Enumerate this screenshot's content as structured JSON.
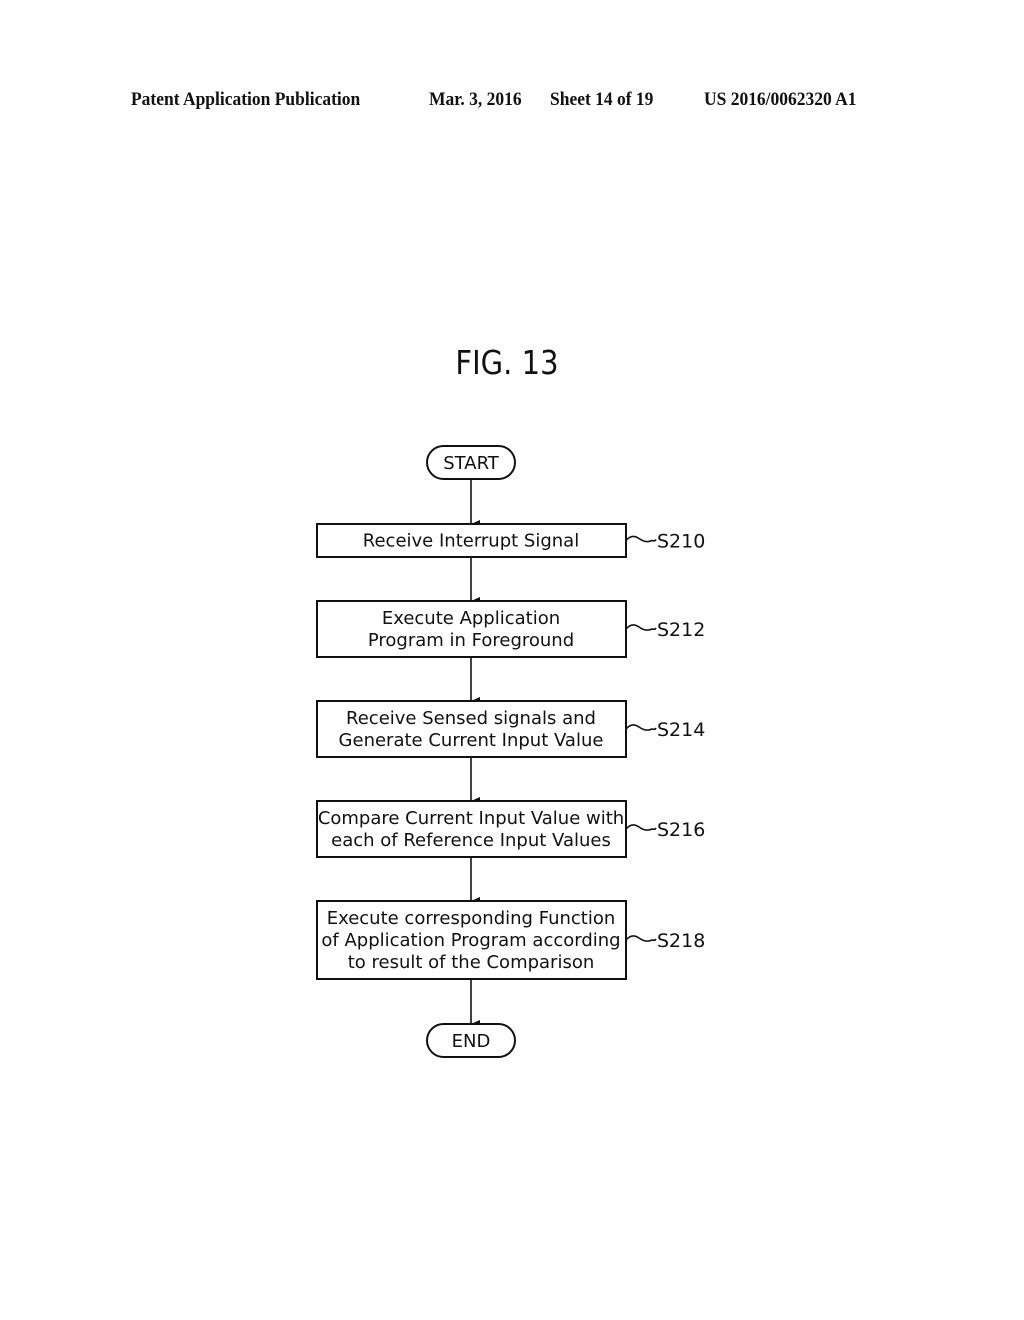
{
  "header": {
    "left": "Patent Application Publication",
    "date": "Mar. 3, 2016",
    "sheet": "Sheet 14 of 19",
    "number": "US 2016/0062320 A1"
  },
  "figure": {
    "title": "FIG. 13"
  },
  "flowchart": {
    "start": "START",
    "end": "END",
    "steps": [
      {
        "id": "S210",
        "lines": [
          "Receive Interrupt Signal"
        ]
      },
      {
        "id": "S212",
        "lines": [
          "Execute Application",
          "Program in Foreground"
        ]
      },
      {
        "id": "S214",
        "lines": [
          "Receive Sensed signals and",
          "Generate Current Input Value"
        ]
      },
      {
        "id": "S216",
        "lines": [
          "Compare Current Input Value with",
          "each of Reference Input Values"
        ]
      },
      {
        "id": "S218",
        "lines": [
          "Execute corresponding Function",
          "of Application Program according",
          "to result of the Comparison"
        ]
      }
    ]
  }
}
